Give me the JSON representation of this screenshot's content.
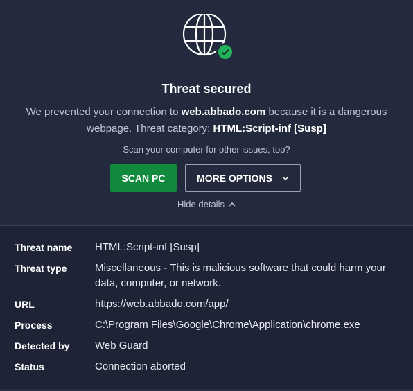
{
  "header": {
    "title": "Threat secured",
    "description": {
      "part1": "We prevented your connection to ",
      "domain": "web.abbado.com",
      "part2": " because it is a dangerous webpage. Threat category: ",
      "category": "HTML:Script-inf [Susp]"
    },
    "prompt": "Scan your computer for other issues, too?",
    "scan_button": "SCAN PC",
    "more_button": "MORE OPTIONS",
    "hide_details": "Hide details"
  },
  "details": [
    {
      "key": "Threat name",
      "value": "HTML:Script-inf [Susp]"
    },
    {
      "key": "Threat type",
      "value": "Miscellaneous - This is malicious software that could harm your data, computer, or network."
    },
    {
      "key": "URL",
      "value": "https://web.abbado.com/app/"
    },
    {
      "key": "Process",
      "value": "C:\\Program Files\\Google\\Chrome\\Application\\chrome.exe"
    },
    {
      "key": "Detected by",
      "value": "Web Guard"
    },
    {
      "key": "Status",
      "value": "Connection aborted"
    }
  ],
  "colors": {
    "background": "#242a3d",
    "details_background": "#1f2336",
    "accent_green": "#128a3e",
    "badge_green": "#21b35b"
  },
  "icons": {
    "globe": "globe-icon",
    "check": "checkmark-icon",
    "more_chevron": "chevron-down-icon",
    "hide_chevron": "chevron-up-icon"
  }
}
